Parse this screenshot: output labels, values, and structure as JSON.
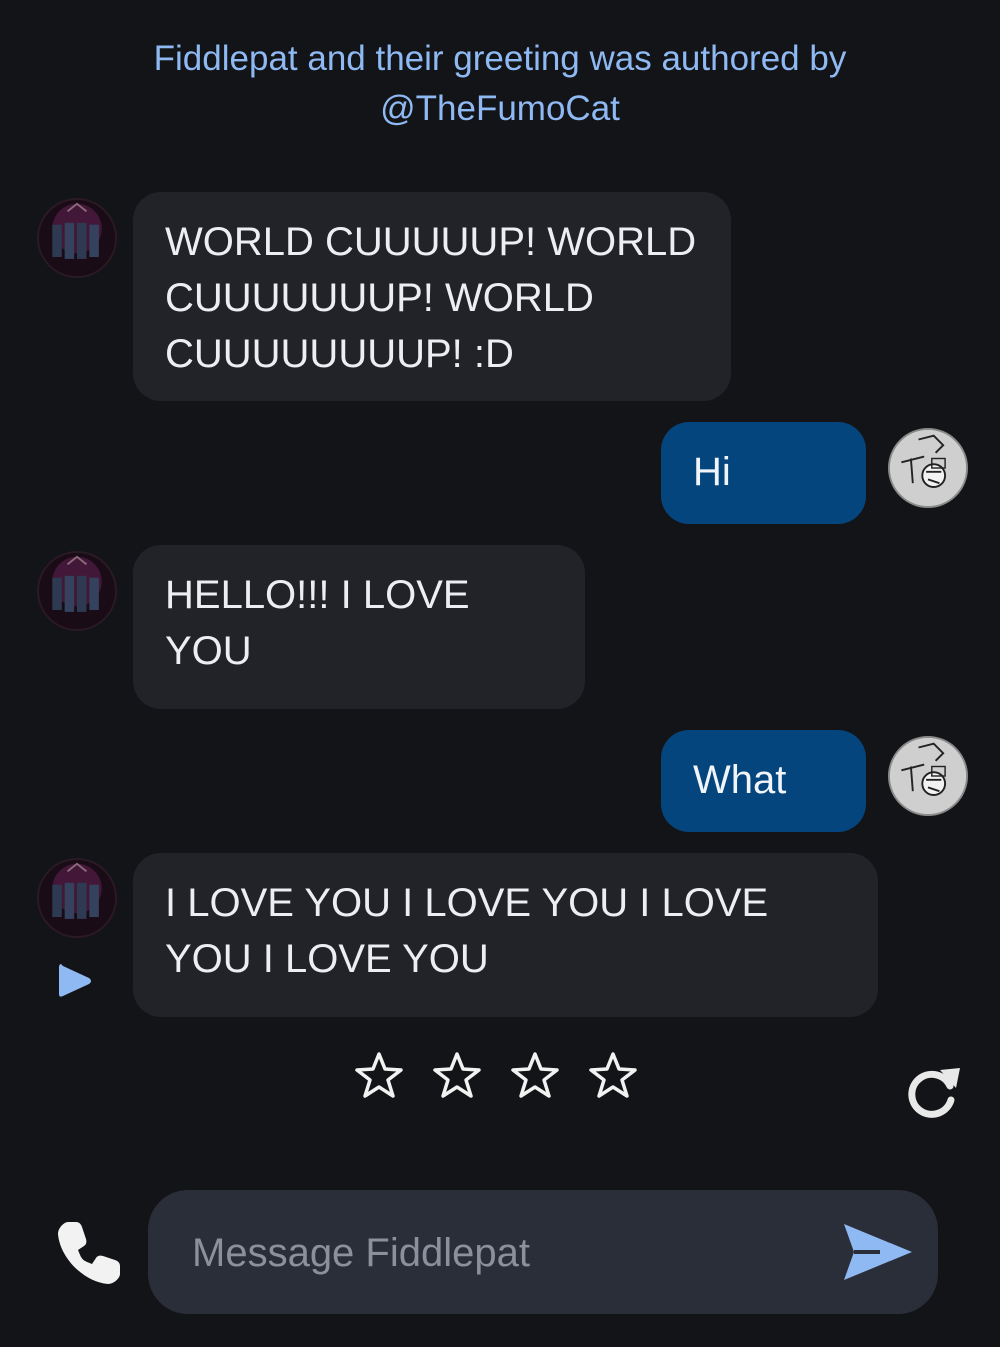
{
  "header": {
    "line1": "Fiddlepat and their greeting was authored by",
    "line2": "@TheFumoCat"
  },
  "messages": [
    {
      "role": "bot",
      "text": "WORLD CUUUUUP! WORLD CUUUUUUUP! WORLD CUUUUUUUUP! :D"
    },
    {
      "role": "user",
      "text": "Hi"
    },
    {
      "role": "bot",
      "text": "HELLO!!! I LOVE YOU"
    },
    {
      "role": "user",
      "text": "What"
    },
    {
      "role": "bot",
      "text": "I LOVE YOU I LOVE YOU I LOVE YOU I LOVE YOU"
    }
  ],
  "rating": {
    "stars_total": 4,
    "stars_filled": 0
  },
  "composer": {
    "placeholder": "Message Fiddlepat"
  },
  "icons": {
    "play": "play-icon",
    "star": "star-outline-icon",
    "regenerate": "refresh-icon",
    "phone": "phone-icon",
    "send": "send-icon"
  },
  "colors": {
    "background": "#131417",
    "bot_bubble": "#212328",
    "user_bubble": "#04457e",
    "accent": "#8fb9f3",
    "input_bg": "#2a2e38"
  }
}
